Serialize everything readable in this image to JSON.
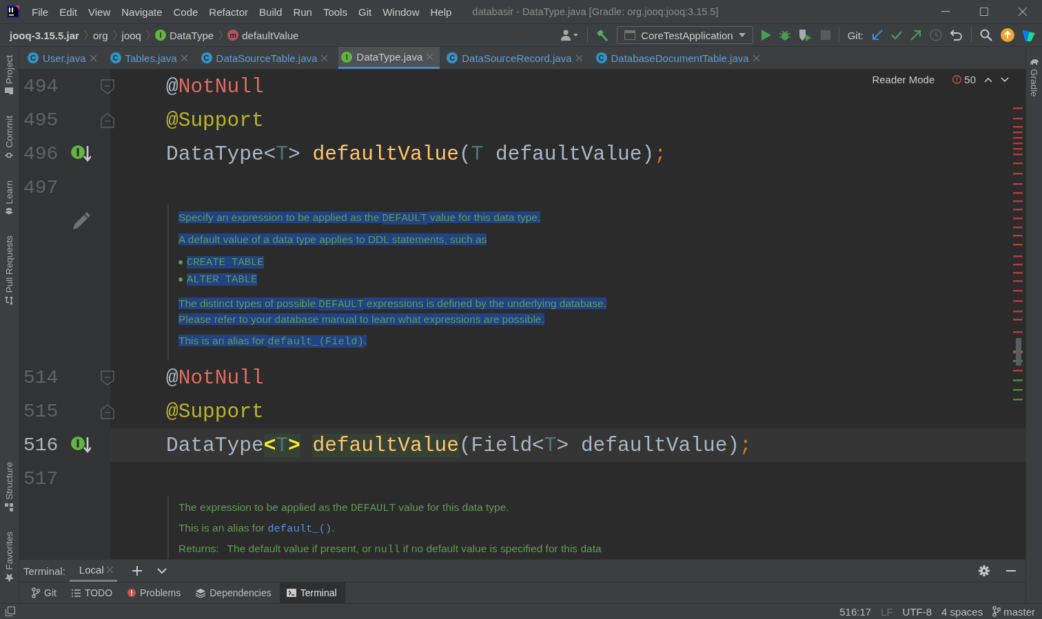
{
  "window": {
    "title": "databasir - DataType.java [Gradle: org.jooq:jooq:3.15.5]"
  },
  "menu": [
    "File",
    "Edit",
    "View",
    "Navigate",
    "Code",
    "Refactor",
    "Build",
    "Run",
    "Tools",
    "Git",
    "Window",
    "Help"
  ],
  "breadcrumbs": [
    {
      "label": "jooq-3.15.5.jar",
      "bold": true
    },
    {
      "label": "org",
      "bold": false
    },
    {
      "label": "jooq",
      "bold": false
    },
    {
      "label": "DataType",
      "bold": false,
      "kind": "interface",
      "icon": "I"
    },
    {
      "label": "defaultValue",
      "bold": false,
      "kind": "method",
      "icon": "m"
    }
  ],
  "toolbar": {
    "run_config": "CoreTestApplication",
    "git_label": "Git:"
  },
  "left_strip_top": [
    {
      "label": "Project",
      "kind": "folder"
    },
    {
      "label": "Commit",
      "kind": "commit"
    },
    {
      "label": "Learn",
      "kind": "learn"
    },
    {
      "label": "Pull Requests",
      "kind": "pull"
    }
  ],
  "left_strip_bottom": [
    {
      "label": "Structure",
      "kind": "structure"
    },
    {
      "label": "Favorites",
      "kind": "star"
    }
  ],
  "right_strip": [
    {
      "label": "Gradle",
      "kind": "gradle"
    }
  ],
  "tabs": [
    {
      "label": "User.java",
      "icon": "C",
      "kind": "class",
      "selected": false
    },
    {
      "label": "Tables.java",
      "icon": "C",
      "kind": "class",
      "selected": false
    },
    {
      "label": "DataSourceTable.java",
      "icon": "C",
      "kind": "class",
      "selected": false
    },
    {
      "label": "DataType.java",
      "icon": "I",
      "kind": "interface",
      "selected": true
    },
    {
      "label": "DataSourceRecord.java",
      "icon": "C",
      "kind": "class",
      "selected": false
    },
    {
      "label": "DatabaseDocumentTable.java",
      "icon": "C",
      "kind": "class",
      "selected": false
    }
  ],
  "editor": {
    "reader_mode": "Reader Mode",
    "problems_count": "50",
    "blocks": [
      {
        "kind": "code",
        "number": "494",
        "fold_start": true,
        "fold_end": false,
        "implemented": false,
        "current": false,
        "segments": [
          {
            "text": "@",
            "kind": "punct",
            "highlight": false
          },
          {
            "text": "NotNull",
            "kind": "unresolved",
            "highlight": false
          }
        ]
      },
      {
        "kind": "code",
        "number": "495",
        "fold_start": false,
        "fold_end": true,
        "implemented": false,
        "current": false,
        "segments": [
          {
            "text": "@Support",
            "kind": "annotation",
            "highlight": false
          }
        ]
      },
      {
        "kind": "code",
        "number": "496",
        "fold_start": false,
        "fold_end": false,
        "implemented": true,
        "current": false,
        "segments": [
          {
            "text": "DataType<",
            "kind": "plain",
            "highlight": false
          },
          {
            "text": "T",
            "kind": "type_param",
            "highlight": false
          },
          {
            "text": "> ",
            "kind": "plain",
            "highlight": false
          },
          {
            "text": "defaultValue",
            "kind": "method",
            "highlight": false
          },
          {
            "text": "(",
            "kind": "plain",
            "highlight": false
          },
          {
            "text": "T",
            "kind": "type_param",
            "highlight": false
          },
          {
            "text": " defaultValue)",
            "kind": "plain",
            "highlight": false
          },
          {
            "text": ";",
            "kind": "keyword",
            "highlight": false
          }
        ]
      },
      {
        "kind": "code",
        "number": "497",
        "fold_start": false,
        "fold_end": false,
        "implemented": false,
        "current": false
      },
      {
        "kind": "doc",
        "selected": true,
        "edit_icon": true,
        "paragraphs": [
          {
            "kind": "text",
            "lines": [
              [
                {
                  "text": "Specify an expression to be applied as the ",
                  "kind": "text"
                },
                {
                  "text": "DEFAULT",
                  "kind": "code"
                },
                {
                  "text": " value for this data type.",
                  "kind": "text"
                }
              ]
            ]
          },
          {
            "kind": "text",
            "lines": [
              [
                {
                  "text": "A default value of a data type applies to DDL statements, such as",
                  "kind": "text"
                }
              ]
            ]
          },
          {
            "kind": "bullets",
            "items": [
              "CREATE TABLE",
              "ALTER TABLE"
            ]
          },
          {
            "kind": "text",
            "lines": [
              [
                {
                  "text": "The distinct types of possible ",
                  "kind": "text"
                },
                {
                  "text": "DEFAULT",
                  "kind": "code"
                },
                {
                  "text": " expressions is defined by the underlying database.",
                  "kind": "text"
                }
              ],
              [
                {
                  "text": "Please refer to your database manual to learn what expressions are possible.",
                  "kind": "text"
                }
              ]
            ]
          },
          {
            "kind": "text",
            "lines": [
              [
                {
                  "text": "This is an alias for ",
                  "kind": "text"
                },
                {
                  "text": "default_(Field)",
                  "kind": "code"
                },
                {
                  "text": ".",
                  "kind": "text"
                }
              ]
            ]
          }
        ]
      },
      {
        "kind": "code",
        "number": "514",
        "fold_start": true,
        "fold_end": false,
        "implemented": false,
        "current": false,
        "segments": [
          {
            "text": "@",
            "kind": "punct",
            "highlight": false
          },
          {
            "text": "NotNull",
            "kind": "unresolved",
            "highlight": false
          }
        ]
      },
      {
        "kind": "code",
        "number": "515",
        "fold_start": false,
        "fold_end": true,
        "implemented": false,
        "current": false,
        "segments": [
          {
            "text": "@Support",
            "kind": "annotation",
            "highlight": false
          }
        ]
      },
      {
        "kind": "code",
        "number": "516",
        "fold_start": false,
        "fold_end": false,
        "implemented": true,
        "current": true,
        "segments": [
          {
            "text": "DataType",
            "kind": "plain",
            "highlight": false
          },
          {
            "text": "<",
            "kind": "brace_match",
            "highlight": true
          },
          {
            "text": "T",
            "kind": "type_param",
            "highlight": true
          },
          {
            "text": ">",
            "kind": "brace_match",
            "highlight": true
          },
          {
            "text": " defaultValue",
            "kind": "method",
            "highlight": true
          },
          {
            "text": "(Field<",
            "kind": "plain",
            "highlight": false
          },
          {
            "text": "T",
            "kind": "type_param",
            "highlight": false
          },
          {
            "text": "> defaultValue)",
            "kind": "plain",
            "highlight": false
          },
          {
            "text": ";",
            "kind": "keyword",
            "highlight": false
          }
        ]
      },
      {
        "kind": "code",
        "number": "517",
        "fold_start": false,
        "fold_end": false,
        "implemented": false,
        "current": false
      },
      {
        "kind": "doc",
        "selected": false,
        "edit_icon": false,
        "paragraphs": [
          {
            "kind": "text",
            "lines": [
              [
                {
                  "text": "The expression to be applied as the ",
                  "kind": "text"
                },
                {
                  "text": "DEFAULT",
                  "kind": "code"
                },
                {
                  "text": " value for this data type.",
                  "kind": "text"
                }
              ]
            ]
          },
          {
            "kind": "text",
            "lines": [
              [
                {
                  "text": "This is an alias for ",
                  "kind": "text"
                },
                {
                  "text": "default_()",
                  "kind": "link"
                },
                {
                  "text": ".",
                  "kind": "text"
                }
              ]
            ]
          },
          {
            "kind": "text",
            "lines": [
              [
                {
                  "text": "Returns:",
                  "kind": "label"
                },
                {
                  "text": "The default value if present, or ",
                  "kind": "text"
                },
                {
                  "text": "null",
                  "kind": "code"
                },
                {
                  "text": " if no default value is specified for this data",
                  "kind": "text"
                }
              ]
            ]
          }
        ]
      }
    ]
  },
  "terminal": {
    "label": "Terminal:",
    "tabs": [
      {
        "label": "Local",
        "selected": true
      }
    ]
  },
  "tool_windows": [
    {
      "label": "Git",
      "kind": "git",
      "selected": false
    },
    {
      "label": "TODO",
      "kind": "todo",
      "selected": false
    },
    {
      "label": "Problems",
      "kind": "problems",
      "selected": false
    },
    {
      "label": "Dependencies",
      "kind": "dependencies",
      "selected": false
    },
    {
      "label": "Terminal",
      "kind": "terminal",
      "selected": true
    }
  ],
  "status_bar": {
    "position": "516:17",
    "line_separator": "LF",
    "encoding": "UTF-8",
    "indent": "4 spaces",
    "branch": "master"
  }
}
